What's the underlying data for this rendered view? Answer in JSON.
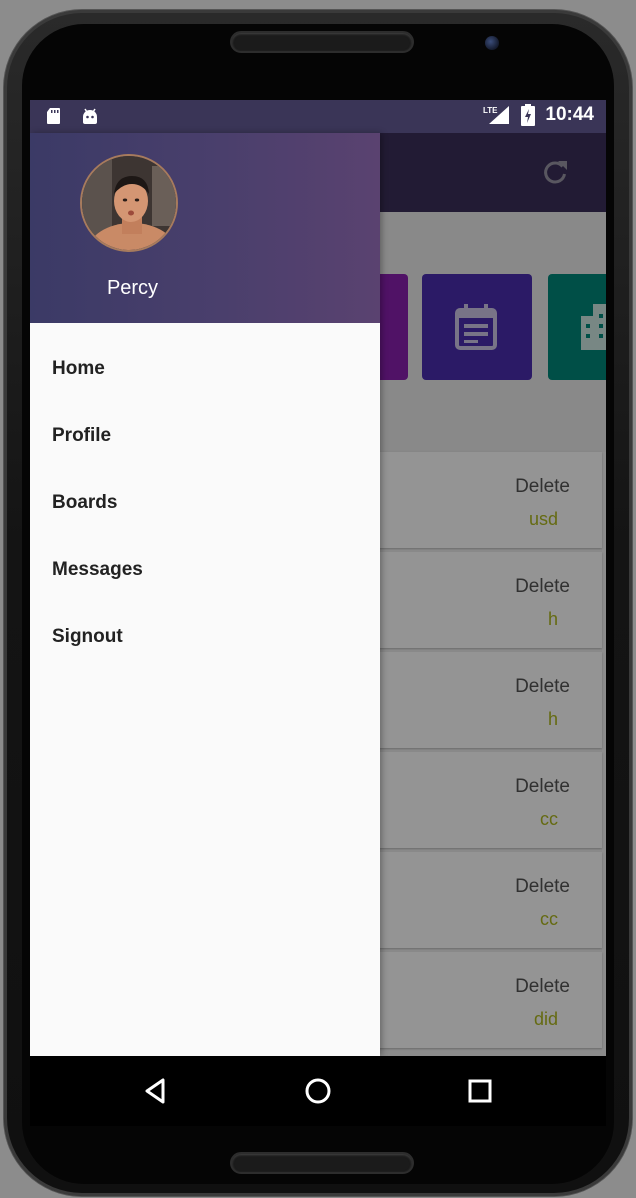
{
  "status_bar": {
    "time": "10:44",
    "network": "LTE",
    "left_icons": [
      "sd-card-icon",
      "android-icon"
    ],
    "right_icons": [
      "signal-icon",
      "battery-icon"
    ]
  },
  "app_bar": {
    "refresh_icon": "refresh-icon",
    "background": "#3b2f5a"
  },
  "tiles": [
    {
      "icon": "unknown-icon",
      "color": "#8a1fb0"
    },
    {
      "icon": "calendar-icon",
      "color": "#4a2db0"
    },
    {
      "icon": "building-icon",
      "color": "#00897b"
    }
  ],
  "cards": [
    {
      "action": "Delete",
      "note": "usd"
    },
    {
      "action": "Delete",
      "note": "h"
    },
    {
      "action": "Delete",
      "note": "h"
    },
    {
      "action": "Delete",
      "note": "cc"
    },
    {
      "action": "Delete",
      "note": "cc"
    },
    {
      "action": "Delete",
      "note": "did"
    }
  ],
  "drawer": {
    "user_name": "Percy",
    "avatar_icon": "avatar-photo",
    "menu": [
      "Home",
      "Profile",
      "Boards",
      "Messages",
      "Signout"
    ]
  },
  "nav_bar": {
    "icons": [
      "back-icon",
      "home-icon",
      "recents-icon"
    ]
  },
  "colors": {
    "accent_text": "#aeb820",
    "drawer_header": "#4a3f6c"
  }
}
